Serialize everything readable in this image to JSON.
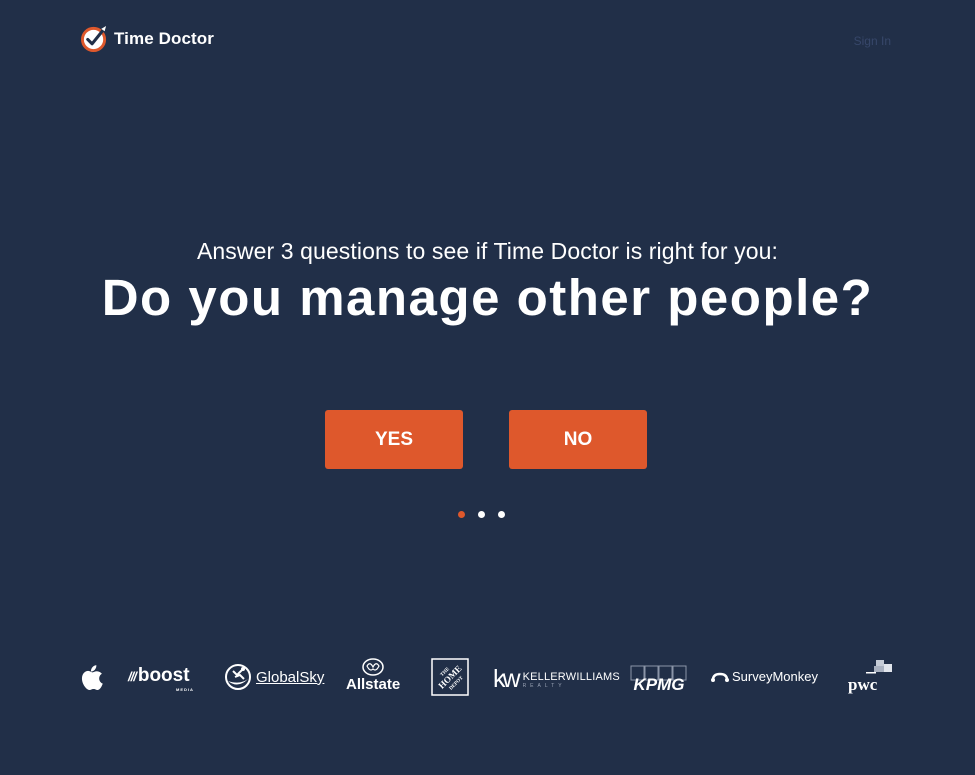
{
  "header": {
    "brand_name": "Time Doctor",
    "logo_icon": "clock-check-icon",
    "sign_in_label": "Sign In"
  },
  "hero": {
    "subtitle": "Answer 3 questions to see if Time Doctor is right for you:",
    "question": "Do you manage other people?",
    "yes_label": "YES",
    "no_label": "NO"
  },
  "progress": {
    "total_steps": 3,
    "current_step": 1
  },
  "colors": {
    "background": "#212f48",
    "accent": "#de582c",
    "text": "#ffffff"
  },
  "clients": {
    "apple": "apple-logo",
    "boost": "boost",
    "boost_sub": "MEDIA",
    "globalsky": "GlobalSky",
    "allstate": "Allstate",
    "homedepot": "THE HOME DEPOT",
    "kw_mark": "kw",
    "kw_name": "KELLERWILLIAMS",
    "kw_sub": "REALTY",
    "kpmg": "KPMG",
    "surveymonkey": "SurveyMonkey",
    "pwc": "pwc"
  }
}
